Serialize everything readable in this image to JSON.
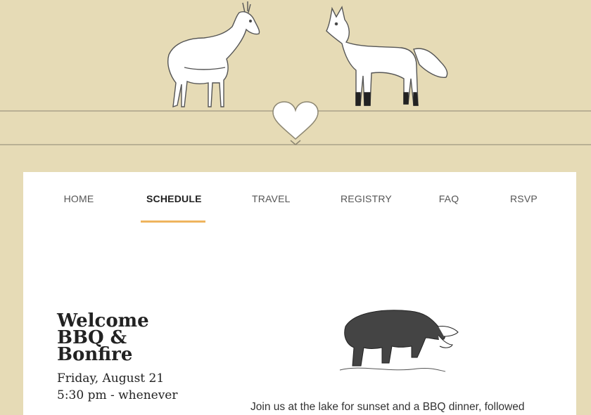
{
  "header": {
    "left_animal": "deer-illustration",
    "right_animal": "fox-illustration",
    "center_icon": "heart-icon"
  },
  "nav": {
    "items": [
      {
        "label": "HOME"
      },
      {
        "label": "SCHEDULE"
      },
      {
        "label": "TRAVEL"
      },
      {
        "label": "REGISTRY"
      },
      {
        "label": "FAQ"
      },
      {
        "label": "RSVP"
      }
    ],
    "active": "SCHEDULE"
  },
  "event": {
    "title": "Welcome BBQ & Bonfire",
    "date": "Friday, August 21",
    "time": "5:30 pm - whenever",
    "description": "Join us at the lake for sunset and a BBQ dinner, followed",
    "illustration": "bear-with-fish-illustration"
  },
  "colors": {
    "background": "#e6dbb6",
    "card": "#ffffff",
    "accent": "#efb45e",
    "text": "#222222"
  }
}
